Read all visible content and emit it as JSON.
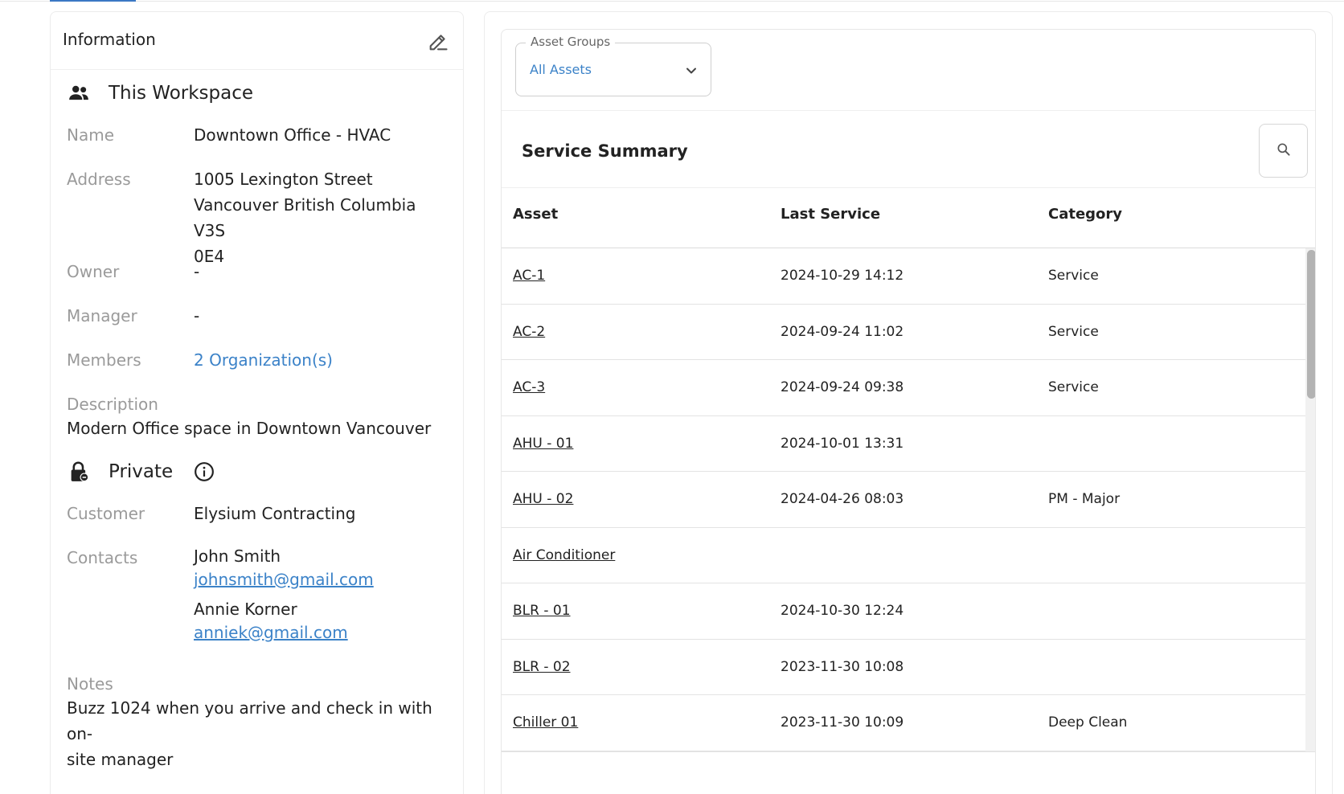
{
  "information": {
    "title": "Information",
    "workspace_section": "This Workspace",
    "fields": {
      "name_label": "Name",
      "name_value": "Downtown Office - HVAC",
      "address_label": "Address",
      "address_line1": "1005 Lexington Street",
      "address_line2": "Vancouver British Columbia V3S",
      "address_line3": "0E4",
      "owner_label": "Owner",
      "owner_value": "-",
      "manager_label": "Manager",
      "manager_value": "-",
      "members_label": "Members",
      "members_value": "2 Organization(s)",
      "description_label": "Description",
      "description_value": "Modern Office space in Downtown Vancouver"
    },
    "private_section": "Private",
    "private_fields": {
      "customer_label": "Customer",
      "customer_value": "Elysium Contracting",
      "contacts_label": "Contacts",
      "contacts": [
        {
          "name": "John Smith",
          "email": "johnsmith@gmail.com"
        },
        {
          "name": "Annie Korner",
          "email": "anniek@gmail.com"
        }
      ],
      "notes_label": "Notes",
      "notes_line1": "Buzz 1024 when you arrive and check in with on-",
      "notes_line2": "site manager"
    }
  },
  "asset_groups": {
    "legend": "Asset Groups",
    "selected": "All Assets"
  },
  "service_summary": {
    "title": "Service Summary",
    "columns": [
      "Asset",
      "Last Service",
      "Category"
    ],
    "rows": [
      {
        "asset": "AC-1",
        "last_service": "2024-10-29 14:12",
        "category": "Service"
      },
      {
        "asset": "AC-2",
        "last_service": "2024-09-24 11:02",
        "category": "Service"
      },
      {
        "asset": "AC-3",
        "last_service": "2024-09-24 09:38",
        "category": "Service"
      },
      {
        "asset": "AHU - 01",
        "last_service": "2024-10-01 13:31",
        "category": ""
      },
      {
        "asset": "AHU - 02",
        "last_service": "2024-04-26 08:03",
        "category": "PM - Major"
      },
      {
        "asset": "Air Conditioner",
        "last_service": "",
        "category": ""
      },
      {
        "asset": "BLR - 01",
        "last_service": "2024-10-30 12:24",
        "category": ""
      },
      {
        "asset": "BLR - 02",
        "last_service": "2023-11-30 10:08",
        "category": ""
      },
      {
        "asset": "Chiller 01",
        "last_service": "2023-11-30 10:09",
        "category": "Deep Clean"
      }
    ]
  },
  "icons": {
    "edit": "edit-icon",
    "people": "people-icon",
    "lock": "lock-icon",
    "info": "info-icon",
    "search": "search-icon",
    "chevron": "chevron-down-icon"
  },
  "colors": {
    "link": "#3b82c8",
    "accent": "#3b78c4",
    "label": "#9a9a9a"
  }
}
